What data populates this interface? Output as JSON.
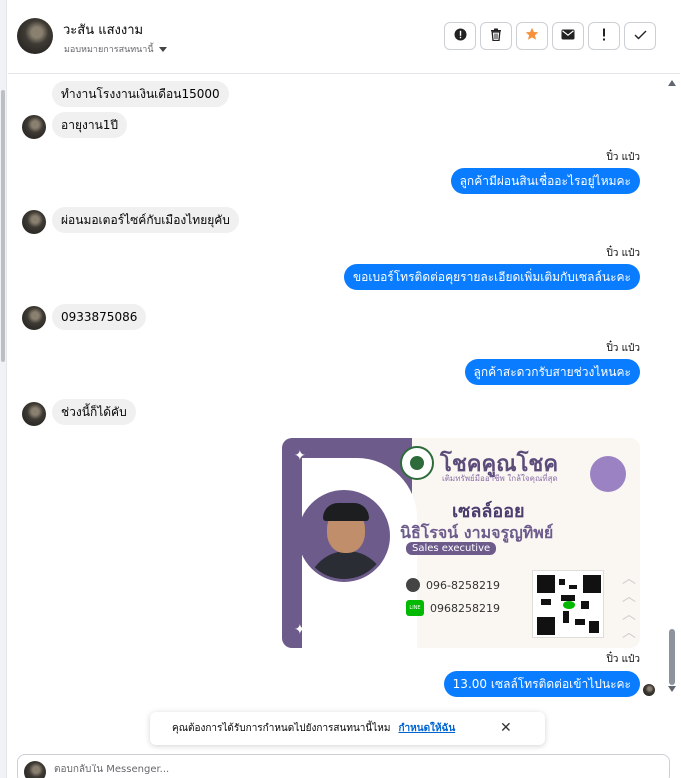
{
  "header": {
    "contact_name": "วะสัน แสงงาม",
    "assign_label": "มอบหมายการสนทนานี้",
    "tools": [
      {
        "icon": "alert-circle-icon",
        "glyph": "❗"
      },
      {
        "icon": "trash-icon",
        "glyph": "🗑"
      },
      {
        "icon": "star-icon",
        "glyph": "★",
        "color": "#f7923a"
      },
      {
        "icon": "mail-icon",
        "glyph": "✉"
      },
      {
        "icon": "exclamation-icon",
        "glyph": "!"
      },
      {
        "icon": "check-icon",
        "glyph": "✓"
      }
    ]
  },
  "messages": {
    "in_1": "ทำงานโรงงานเงินเดือน15000",
    "in_2": "อายุงาน1ปี",
    "sender": "ปิ๋ว แป๋ว",
    "out_1": "ลูกค้ามีผ่อนสินเชื่ออะไรอยู่ไหมคะ",
    "in_3": "ผ่อนมอเตอร์ไซค์กับเมืองไทยยุคับ",
    "out_2": "ขอเบอร์โทรติดต่อคุยรายละเอียดเพิ่มเติมกับเซลล์นะคะ",
    "in_4": "0933875086",
    "out_3": "ลูกค้าสะดวกรับสายช่วงไหนคะ",
    "in_5": "ช่วงนี้ก็ได้คับ",
    "out_4": "13.00 เซลล์โทรติดต่อเข้าไปนะคะ"
  },
  "card": {
    "brand": "โชคคูณโชค",
    "tagline": "เติมทรัพย์มืออาชีพ ใกล้ใจคุณที่สุด",
    "nickname": "เซลล์ออย",
    "fullname": "นิธิโรจน์ งามจรูญทิพย์",
    "role": "Sales executive",
    "phone": "096-8258219",
    "line_label": "LINE",
    "line_id": "0968258219"
  },
  "notice": {
    "text": "คุณต้องการได้รับการกำหนดไปยังการสนทนานี้ไหม",
    "link": "กำหนดให้ฉัน"
  },
  "composer": {
    "placeholder": "ตอบกลับใน Messenger..."
  },
  "colors": {
    "outgoing": "#0a7cff",
    "incoming": "#f0f0f0",
    "card_accent": "#6d5b8c"
  }
}
